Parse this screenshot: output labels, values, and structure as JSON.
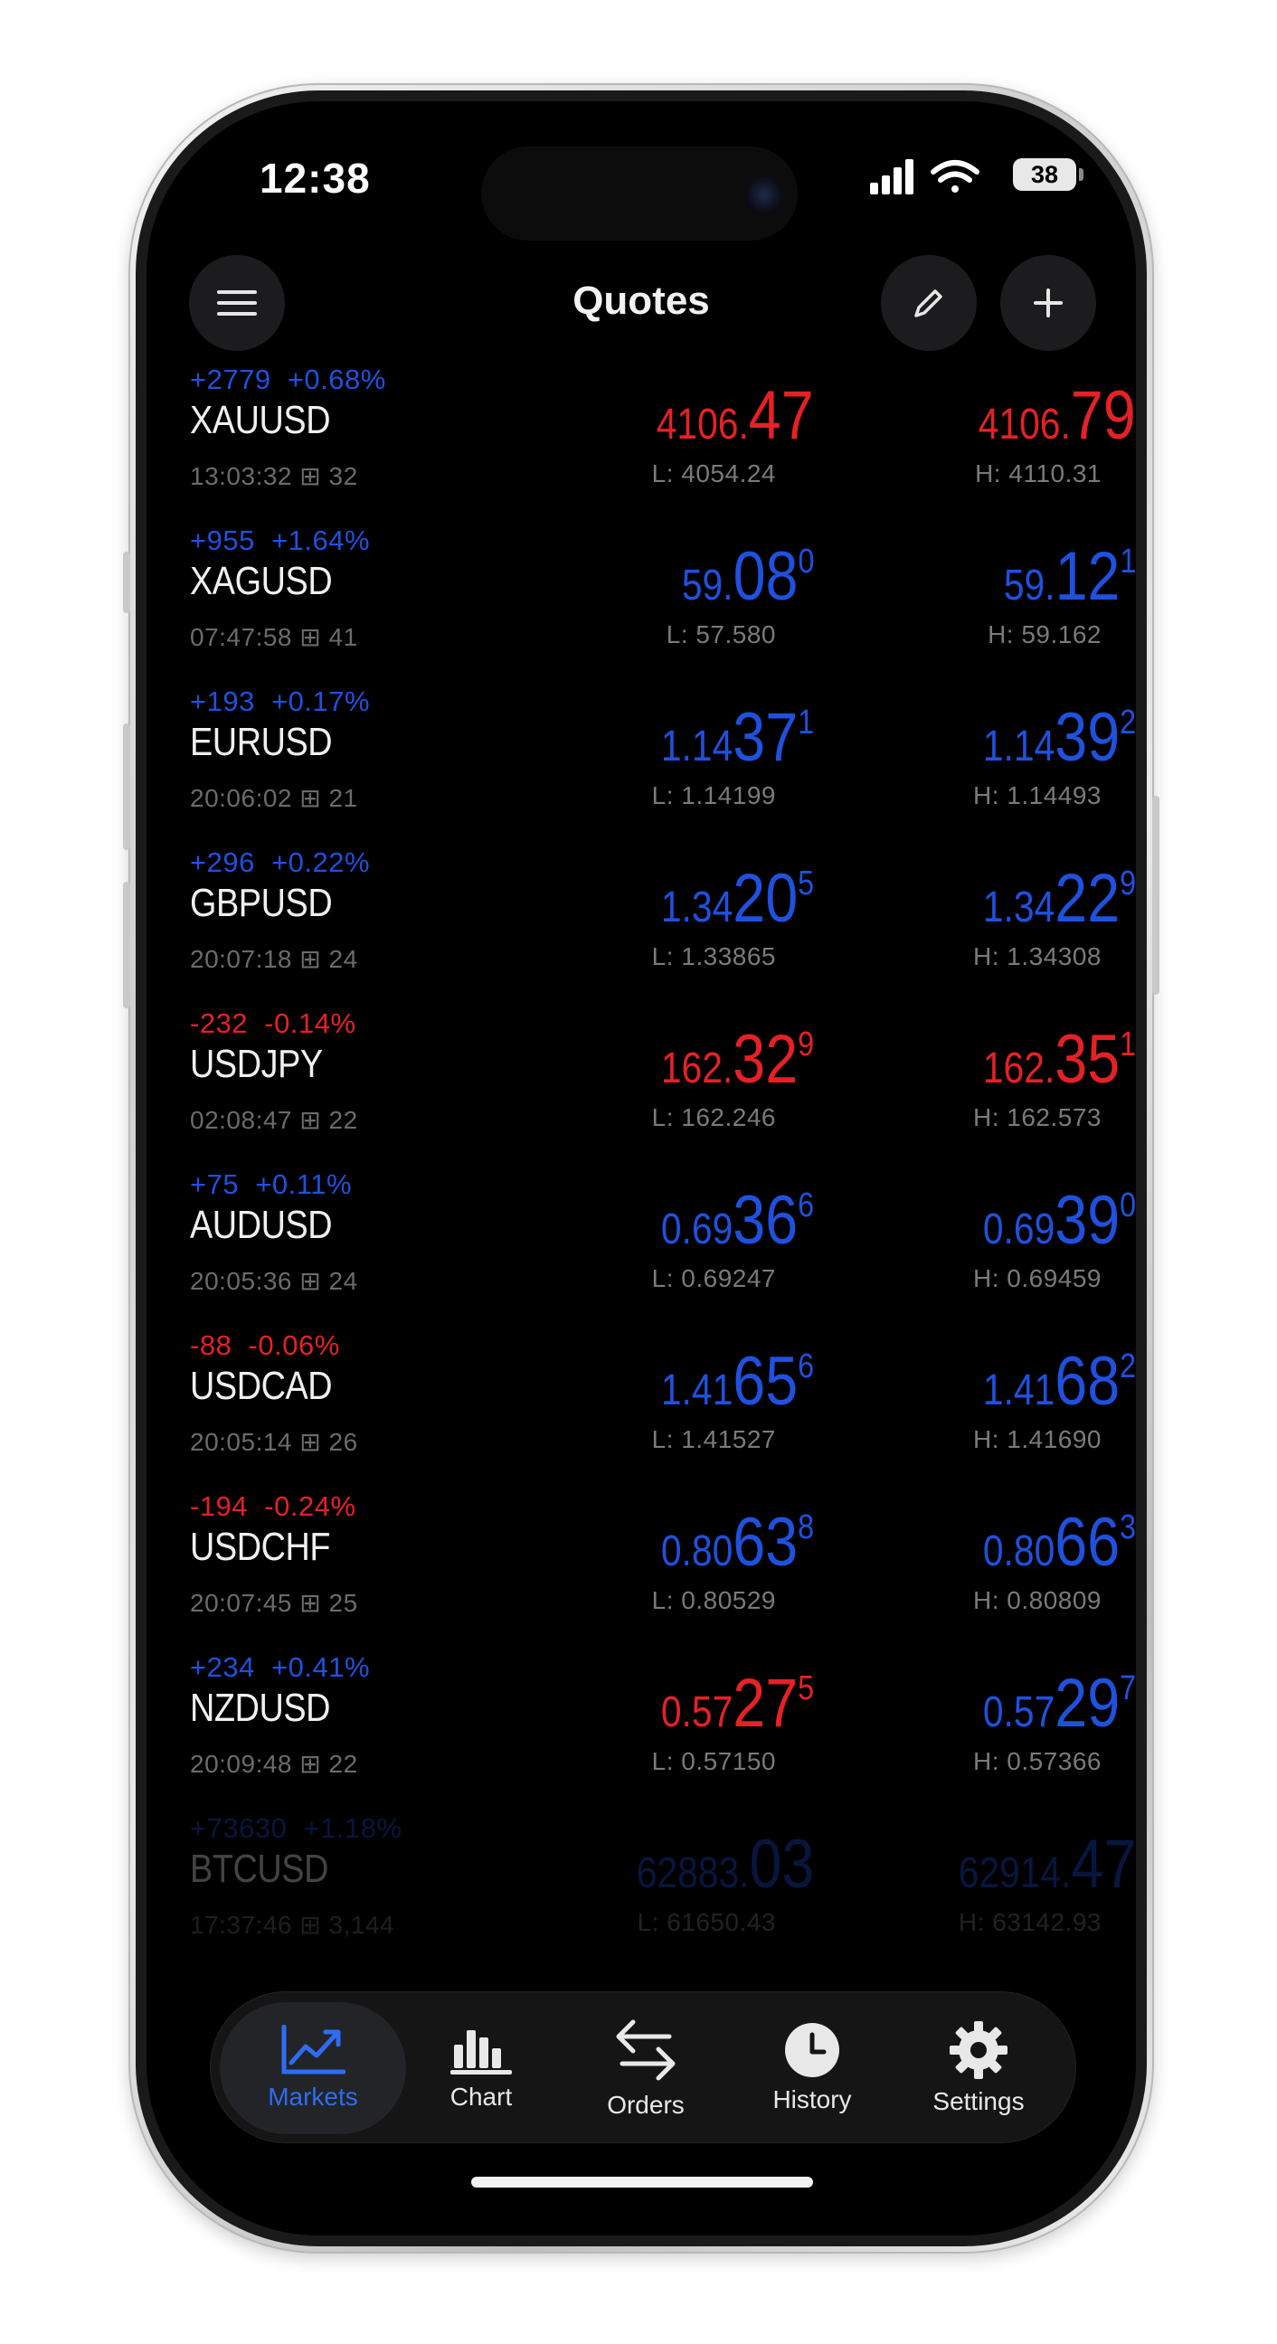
{
  "status_bar": {
    "time": "12:38",
    "battery": "38"
  },
  "header": {
    "title": "Quotes"
  },
  "quotes": [
    {
      "change": "+2779",
      "change_pct": "+0.68%",
      "direction": "up",
      "symbol": "XAUUSD",
      "time": "13:03:32",
      "spread": "32",
      "bid": {
        "prefix": "4106.",
        "big": "47",
        "sup": "",
        "color": "red"
      },
      "low": "L: 4054.24",
      "ask": {
        "prefix": "4106.",
        "big": "79",
        "sup": "",
        "color": "red"
      },
      "high": "H: 4110.31"
    },
    {
      "change": "+955",
      "change_pct": "+1.64%",
      "direction": "up",
      "symbol": "XAGUSD",
      "time": "07:47:58",
      "spread": "41",
      "bid": {
        "prefix": "59.",
        "big": "08",
        "sup": "0",
        "color": "blue"
      },
      "low": "L: 57.580",
      "ask": {
        "prefix": "59.",
        "big": "12",
        "sup": "1",
        "color": "blue"
      },
      "high": "H: 59.162"
    },
    {
      "change": "+193",
      "change_pct": "+0.17%",
      "direction": "up",
      "symbol": "EURUSD",
      "time": "20:06:02",
      "spread": "21",
      "bid": {
        "prefix": "1.14",
        "big": "37",
        "sup": "1",
        "color": "blue"
      },
      "low": "L: 1.14199",
      "ask": {
        "prefix": "1.14",
        "big": "39",
        "sup": "2",
        "color": "blue"
      },
      "high": "H: 1.14493"
    },
    {
      "change": "+296",
      "change_pct": "+0.22%",
      "direction": "up",
      "symbol": "GBPUSD",
      "time": "20:07:18",
      "spread": "24",
      "bid": {
        "prefix": "1.34",
        "big": "20",
        "sup": "5",
        "color": "blue"
      },
      "low": "L: 1.33865",
      "ask": {
        "prefix": "1.34",
        "big": "22",
        "sup": "9",
        "color": "blue"
      },
      "high": "H: 1.34308"
    },
    {
      "change": "-232",
      "change_pct": "-0.14%",
      "direction": "down",
      "symbol": "USDJPY",
      "time": "02:08:47",
      "spread": "22",
      "bid": {
        "prefix": "162.",
        "big": "32",
        "sup": "9",
        "color": "red"
      },
      "low": "L: 162.246",
      "ask": {
        "prefix": "162.",
        "big": "35",
        "sup": "1",
        "color": "red"
      },
      "high": "H: 162.573"
    },
    {
      "change": "+75",
      "change_pct": "+0.11%",
      "direction": "up",
      "symbol": "AUDUSD",
      "time": "20:05:36",
      "spread": "24",
      "bid": {
        "prefix": "0.69",
        "big": "36",
        "sup": "6",
        "color": "blue"
      },
      "low": "L: 0.69247",
      "ask": {
        "prefix": "0.69",
        "big": "39",
        "sup": "0",
        "color": "blue"
      },
      "high": "H: 0.69459"
    },
    {
      "change": "-88",
      "change_pct": "-0.06%",
      "direction": "down",
      "symbol": "USDCAD",
      "time": "20:05:14",
      "spread": "26",
      "bid": {
        "prefix": "1.41",
        "big": "65",
        "sup": "6",
        "color": "blue"
      },
      "low": "L: 1.41527",
      "ask": {
        "prefix": "1.41",
        "big": "68",
        "sup": "2",
        "color": "blue"
      },
      "high": "H: 1.41690"
    },
    {
      "change": "-194",
      "change_pct": "-0.24%",
      "direction": "down",
      "symbol": "USDCHF",
      "time": "20:07:45",
      "spread": "25",
      "bid": {
        "prefix": "0.80",
        "big": "63",
        "sup": "8",
        "color": "blue"
      },
      "low": "L: 0.80529",
      "ask": {
        "prefix": "0.80",
        "big": "66",
        "sup": "3",
        "color": "blue"
      },
      "high": "H: 0.80809"
    },
    {
      "change": "+234",
      "change_pct": "+0.41%",
      "direction": "up",
      "symbol": "NZDUSD",
      "time": "20:09:48",
      "spread": "22",
      "bid": {
        "prefix": "0.57",
        "big": "27",
        "sup": "5",
        "color": "red"
      },
      "low": "L: 0.57150",
      "ask": {
        "prefix": "0.57",
        "big": "29",
        "sup": "7",
        "color": "blue"
      },
      "high": "H: 0.57366"
    },
    {
      "change": "+73630",
      "change_pct": "+1.18%",
      "direction": "up",
      "symbol": "BTCUSD",
      "time": "17:37:46",
      "spread": "3,144",
      "bid": {
        "prefix": "62883.",
        "big": "03",
        "sup": "",
        "color": "blue"
      },
      "low": "L: 61650.43",
      "ask": {
        "prefix": "62914.",
        "big": "47",
        "sup": "",
        "color": "blue"
      },
      "high": "H: 63142.93"
    }
  ],
  "tabs": [
    {
      "label": "Markets",
      "icon": "trending-up-chart-icon",
      "active": true
    },
    {
      "label": "Chart",
      "icon": "bar-chart-icon",
      "active": false
    },
    {
      "label": "Orders",
      "icon": "swap-arrows-icon",
      "active": false
    },
    {
      "label": "History",
      "icon": "clock-icon",
      "active": false
    },
    {
      "label": "Settings",
      "icon": "gear-icon",
      "active": false
    }
  ],
  "colors": {
    "up": "#1f51de",
    "down": "#e52126",
    "accent": "#2e6df3"
  }
}
